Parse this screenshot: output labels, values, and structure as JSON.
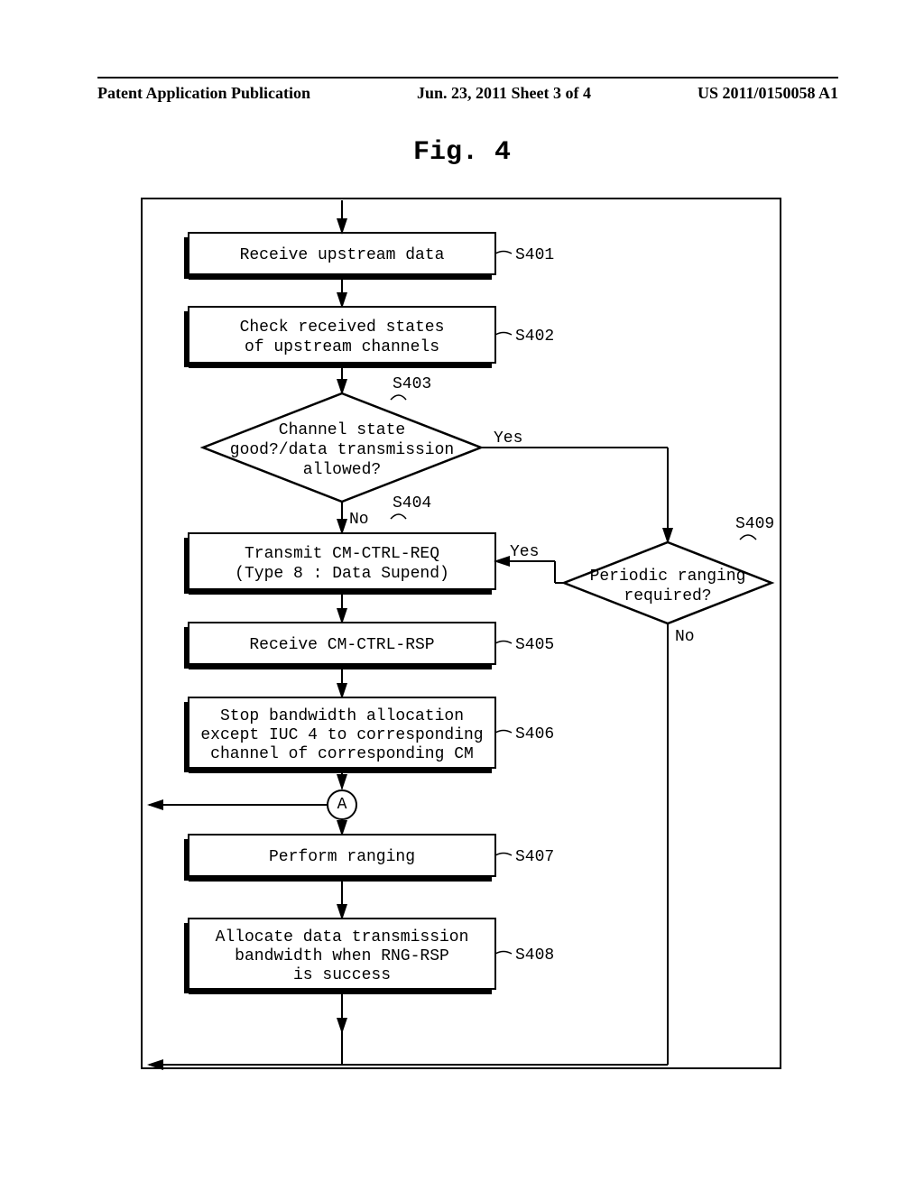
{
  "header": {
    "left": "Patent Application Publication",
    "center": "Jun. 23, 2011  Sheet 3 of 4",
    "right": "US 2011/0150058 A1"
  },
  "figure": {
    "title": "Fig. 4",
    "steps": {
      "s401": {
        "label": "S401",
        "text": "Receive upstream data"
      },
      "s402": {
        "label": "S402",
        "text1": "Check received states",
        "text2": "of upstream channels"
      },
      "s403": {
        "label": "S403",
        "text1": "Channel state",
        "text2": "good?/data transmission",
        "text3": "allowed?"
      },
      "s404": {
        "label": "S404",
        "text1": "Transmit CM-CTRL-REQ",
        "text2": "(Type 8 : Data Supend)"
      },
      "s405": {
        "label": "S405",
        "text": "Receive CM-CTRL-RSP"
      },
      "s406": {
        "label": "S406",
        "text1": "Stop bandwidth allocation",
        "text2": "except IUC 4 to corresponding",
        "text3": "channel of corresponding CM"
      },
      "s407": {
        "label": "S407",
        "text": "Perform ranging"
      },
      "s408": {
        "label": "S408",
        "text1": "Allocate data transmission",
        "text2": "bandwidth when RNG-RSP",
        "text3": "is success"
      },
      "s409": {
        "label": "S409",
        "text1": "Periodic ranging",
        "text2": "required?"
      }
    },
    "branches": {
      "yes": "Yes",
      "no": "No"
    },
    "connector": "A"
  }
}
